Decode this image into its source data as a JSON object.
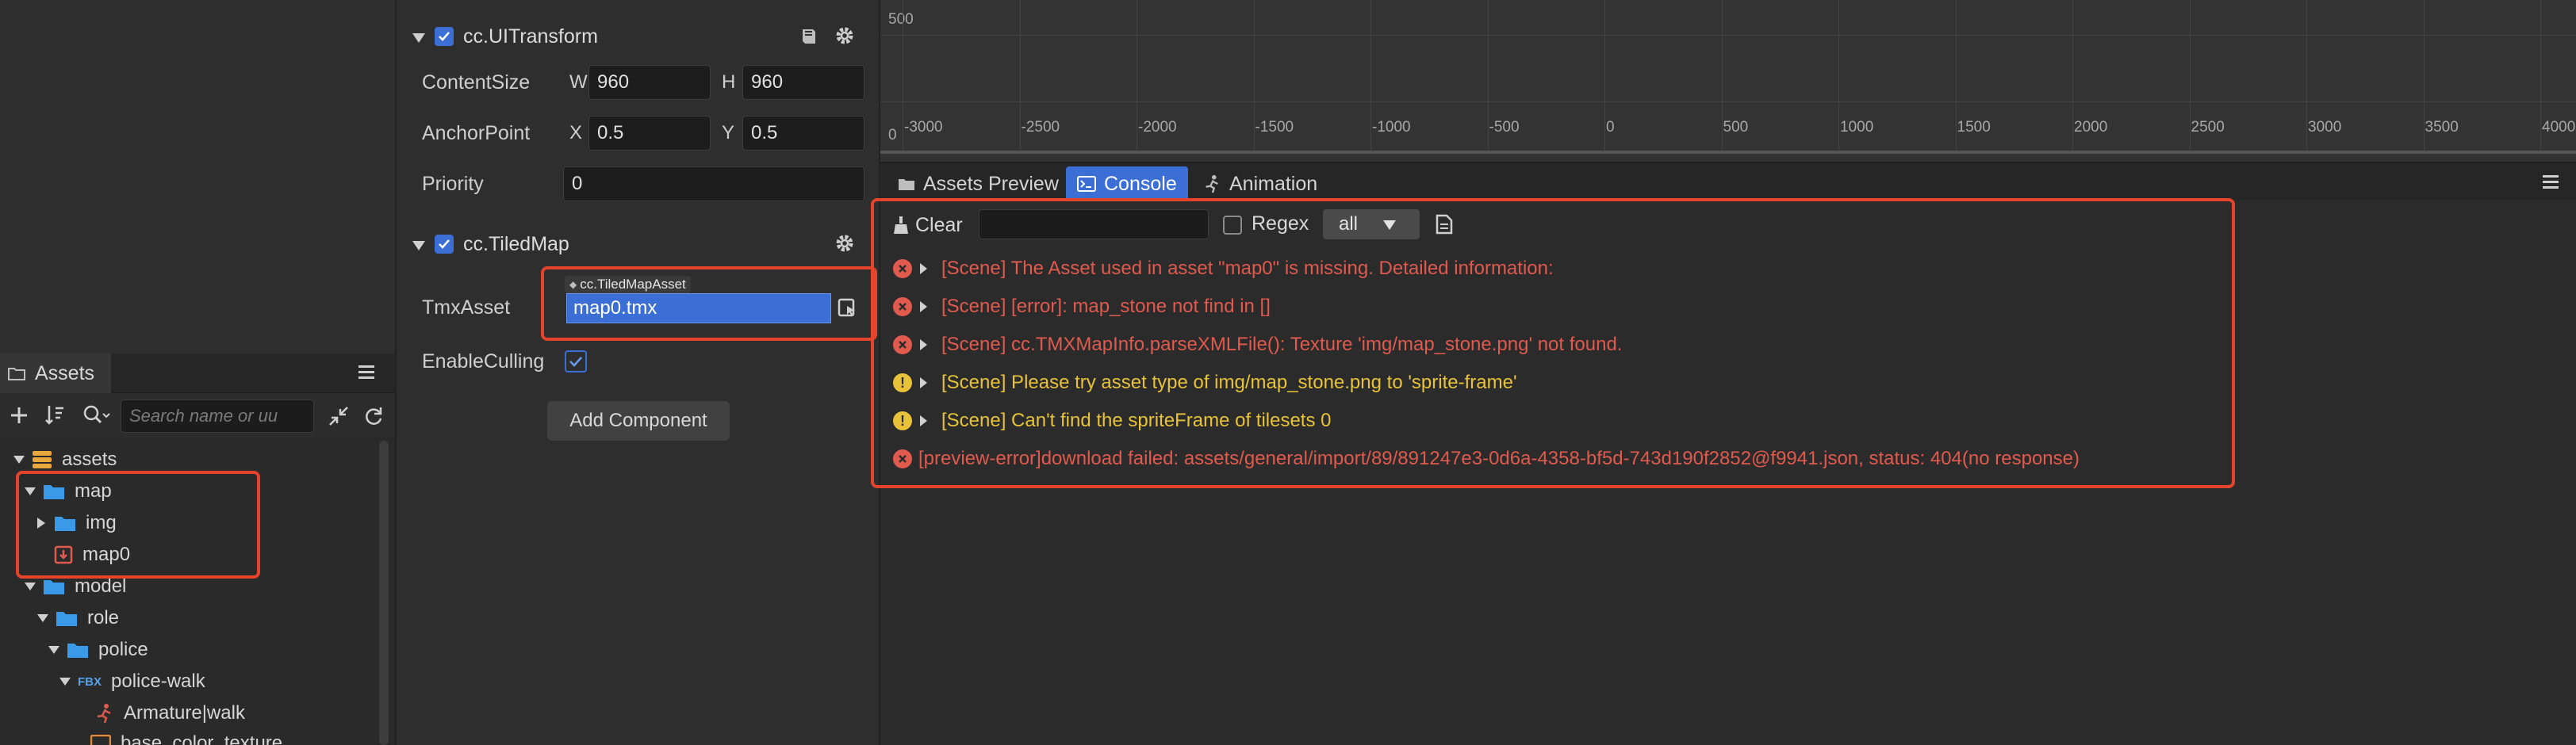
{
  "assets_panel": {
    "tab_label": "Assets",
    "search_placeholder": "Search name or uu",
    "tree": [
      {
        "label": "assets",
        "icon": "database-icon"
      },
      {
        "label": "map",
        "icon": "folder-icon"
      },
      {
        "label": "img",
        "icon": "folder-icon"
      },
      {
        "label": "map0",
        "icon": "tmx-file-icon"
      },
      {
        "label": "model",
        "icon": "folder-icon"
      },
      {
        "label": "role",
        "icon": "folder-icon"
      },
      {
        "label": "police",
        "icon": "folder-icon"
      },
      {
        "label": "police-walk",
        "icon": "fbx-file-icon",
        "badge": "FBX"
      },
      {
        "label": "Armature|walk",
        "icon": "animation-icon"
      },
      {
        "label": "base_color_texture",
        "icon": "texture-icon"
      }
    ]
  },
  "inspector": {
    "ui_transform": {
      "title": "cc.UITransform",
      "content_size_label": "ContentSize",
      "w_label": "W",
      "w_value": "960",
      "h_label": "H",
      "h_value": "960",
      "anchor_label": "AnchorPoint",
      "x_label": "X",
      "x_value": "0.5",
      "y_label": "Y",
      "y_value": "0.5",
      "priority_label": "Priority",
      "priority_value": "0"
    },
    "tiled_map": {
      "title": "cc.TiledMap",
      "tmx_label": "TmxAsset",
      "tmx_type": "cc.TiledMapAsset",
      "tmx_value": "map0.tmx",
      "culling_label": "EnableCulling"
    },
    "add_component_label": "Add Component"
  },
  "scene": {
    "y_ticks": [
      "500",
      "0"
    ],
    "x_ticks": [
      "-3000",
      "-2500",
      "-2000",
      "-1500",
      "-1000",
      "-500",
      "0",
      "500",
      "1000",
      "1500",
      "2000",
      "2500",
      "3000",
      "3500",
      "4000"
    ]
  },
  "dock": {
    "tabs": [
      {
        "label": "Assets Preview",
        "icon": "folder-icon",
        "active": false
      },
      {
        "label": "Console",
        "icon": "terminal-icon",
        "active": true
      },
      {
        "label": "Animation",
        "icon": "animation-icon",
        "active": false
      }
    ]
  },
  "console": {
    "clear_label": "Clear",
    "regex_label": "Regex",
    "level_value": "all",
    "logs": [
      {
        "level": "error",
        "text": "[Scene] The Asset used in asset \"map0\" is missing. Detailed information:",
        "expandable": true
      },
      {
        "level": "error",
        "text": "[Scene] [error]: map_stone not find in []",
        "expandable": true
      },
      {
        "level": "error",
        "text": "[Scene] cc.TMXMapInfo.parseXMLFile(): Texture 'img/map_stone.png' not found.",
        "expandable": true
      },
      {
        "level": "warn",
        "text": "[Scene] Please try asset type of img/map_stone.png to 'sprite-frame'",
        "expandable": true
      },
      {
        "level": "warn",
        "text": "[Scene] Can't find the spriteFrame of tilesets 0",
        "expandable": true
      },
      {
        "level": "error",
        "text": "[preview-error]download failed: assets/general/import/89/891247e3-0d6a-4358-bf5d-743d190f2852@f9941.json, status: 404(no response)",
        "expandable": false
      }
    ]
  },
  "colors": {
    "accent": "#3b6fd6",
    "error": "#e05a4e",
    "warn": "#e8c33a",
    "annotation": "#e4442c",
    "folder": "#3a9ae8"
  }
}
